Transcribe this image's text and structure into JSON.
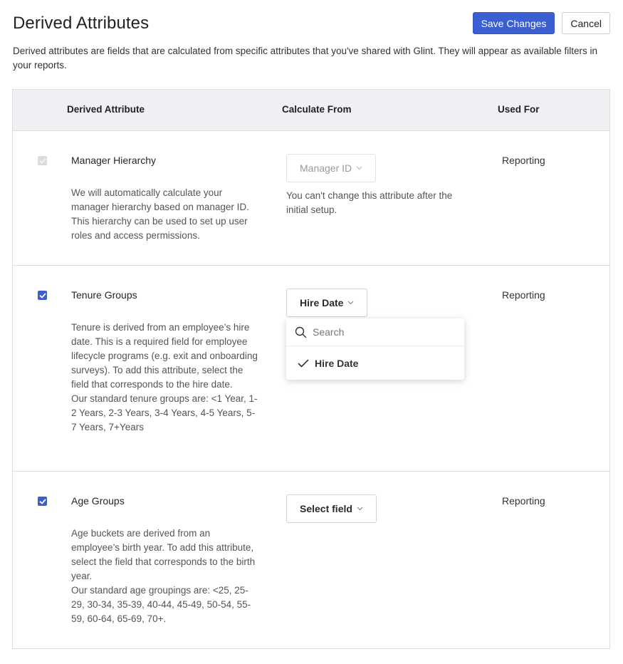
{
  "header": {
    "title": "Derived Attributes",
    "save_label": "Save Changes",
    "cancel_label": "Cancel",
    "description": "Derived attributes are fields that are calculated from specific attributes that you've shared with Glint. They will appear as available filters in your reports."
  },
  "colors": {
    "primary": "#3b5fd1",
    "header_bg": "#eef0f3",
    "border": "#dddddd"
  },
  "table": {
    "columns": [
      "Derived Attribute",
      "Calculate From",
      "Used For"
    ],
    "rows": [
      {
        "name": "Manager Hierarchy",
        "checked": true,
        "disabled": true,
        "description": "We will automatically calculate your manager hierarchy based on manager ID. This hierarchy can be used to set up user roles and access permissions.",
        "calculate_from": "Manager ID",
        "calculate_note": "You can't change this attribute after the initial setup.",
        "used_for": "Reporting"
      },
      {
        "name": "Tenure Groups",
        "checked": true,
        "disabled": false,
        "description_lines": [
          "Tenure is derived from an employee’s hire date. This is a required field for employee lifecycle programs (e.g. exit and onboarding surveys). To add this attribute, select the field that corresponds to the hire date.",
          "Our standard tenure groups are: <1 Year, 1-2 Years, 2-3 Years, 3-4 Years, 4-5 Years, 5-7 Years, 7+Years"
        ],
        "calculate_from": "Hire Date",
        "dropdown": {
          "open": true,
          "search_placeholder": "Search",
          "search_value": "",
          "options": [
            {
              "label": "Hire Date",
              "selected": true
            }
          ]
        },
        "used_for": "Reporting"
      },
      {
        "name": "Age Groups",
        "checked": true,
        "disabled": false,
        "description_lines": [
          "Age buckets are derived from an employee’s birth year. To add this attribute, select the field that corresponds to the birth year.",
          "Our standard age groupings are: <25, 25-29, 30-34, 35-39, 40-44, 45-49, 50-54, 55-59, 60-64, 65-69, 70+."
        ],
        "calculate_from": "Select field",
        "used_for": "Reporting"
      }
    ]
  }
}
